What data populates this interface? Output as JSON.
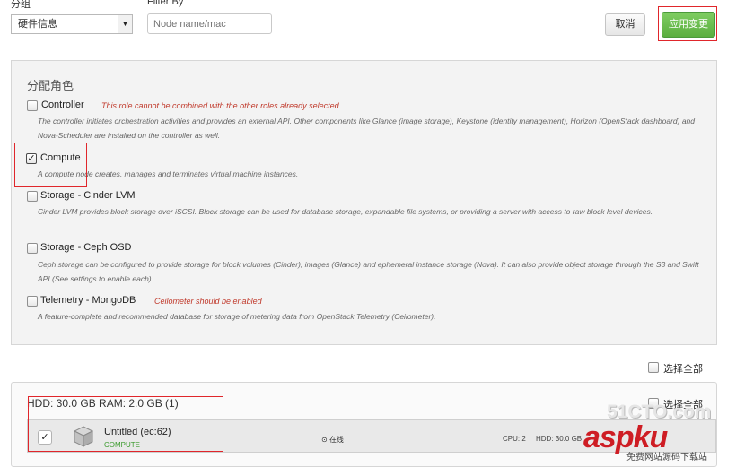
{
  "top": {
    "group_label": "分组",
    "group_value": "硬件信息",
    "filter_label": "Filter By",
    "filter_placeholder": "Node name/mac",
    "cancel_label": "取消",
    "apply_label": "应用变更"
  },
  "roles": {
    "title": "分配角色",
    "items": [
      {
        "name": "Controller",
        "checked": false,
        "warning": "This role cannot be combined with the other roles already selected.",
        "desc": "The controller initiates orchestration activities and provides an external API. Other components like Glance (image storage), Keystone (identity management), Horizon (OpenStack dashboard) and Nova-Scheduler are installed on the controller as well."
      },
      {
        "name": "Compute",
        "checked": true,
        "warning": "",
        "desc": "A compute node creates, manages and terminates virtual machine instances."
      },
      {
        "name": "Storage - Cinder LVM",
        "checked": false,
        "warning": "",
        "desc": "Cinder LVM provides block storage over iSCSI. Block storage can be used for database storage, expandable file systems, or providing a server with access to raw block level devices."
      },
      {
        "name": "Storage - Ceph OSD",
        "checked": false,
        "warning": "",
        "desc": "Ceph storage can be configured to provide storage for block volumes (Cinder), images (Glance) and ephemeral instance storage (Nova). It can also provide object storage through the S3 and Swift API (See settings to enable each)."
      },
      {
        "name": "Telemetry - MongoDB",
        "checked": false,
        "warning": "Ceilometer should be enabled",
        "desc": "A feature-complete and recommended database for storage of metering data from OpenStack Telemetry (Ceilometer)."
      }
    ]
  },
  "select_all": {
    "label": "选择全部"
  },
  "group": {
    "title": "HDD: 30.0 GB   RAM: 2.0 GB (1)",
    "select_all_label": "选择全部",
    "node": {
      "name": "Untitled (ec:62)",
      "role": "COMPUTE",
      "status": "在线",
      "cpu": "CPU: 2",
      "hdd": "HDD: 30.0 GB",
      "checked": true
    }
  },
  "watermark": {
    "line1": "51CTO.com",
    "line2": "aspku",
    "line3": "免费网站源码下载站"
  },
  "colors": {
    "apply_green": "#5aae3f",
    "highlight_red": "#e0262b",
    "warning_red": "#c0392b",
    "role_green": "#3a9a2c"
  }
}
